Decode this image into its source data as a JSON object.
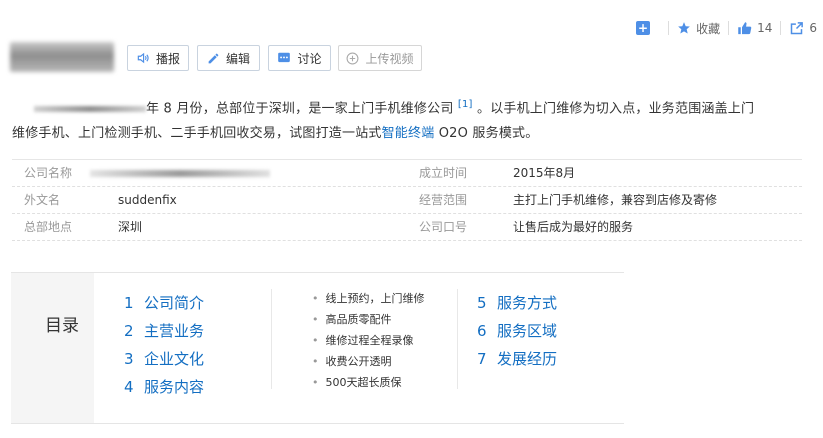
{
  "toolbar": {
    "collect_label": "收藏",
    "like_count": "14",
    "share_count": "6"
  },
  "actions": {
    "broadcast": "播报",
    "edit": "编辑",
    "discuss": "讨论",
    "upload_video": "上传视频"
  },
  "summary": {
    "part1": "年 8 月份，总部位于深圳，是一家上门手机维修公司",
    "ref": "[1]",
    "part2": "。以手机上门维修为切入点，业务范围涵盖上门",
    "part3": "维修手机、上门检测手机、二手手机回收交易，试图打造一站式",
    "link": "智能终端",
    "part4": " O2O 服务模式。"
  },
  "info": {
    "company_name_label": "公司名称",
    "founded_label": "成立时间",
    "founded_value": "2015年8月",
    "foreign_name_label": "外文名",
    "foreign_name_value": "suddenfix",
    "scope_label": "经营范围",
    "scope_value": "主打上门手机维修，兼容到店修及寄修",
    "hq_label": "总部地点",
    "hq_value": "深圳",
    "slogan_label": "公司口号",
    "slogan_value": "让售后成为最好的服务"
  },
  "catalog": {
    "title": "目录",
    "items": [
      {
        "num": "1",
        "label": "公司简介"
      },
      {
        "num": "2",
        "label": "主营业务"
      },
      {
        "num": "3",
        "label": "企业文化"
      },
      {
        "num": "4",
        "label": "服务内容"
      },
      {
        "num": "5",
        "label": "服务方式"
      },
      {
        "num": "6",
        "label": "服务区域"
      },
      {
        "num": "7",
        "label": "发展经历"
      }
    ],
    "subitems": [
      "线上预约，上门维修",
      "高品质零配件",
      "维修过程全程录像",
      "收费公开透明",
      "500天超长质保"
    ]
  }
}
